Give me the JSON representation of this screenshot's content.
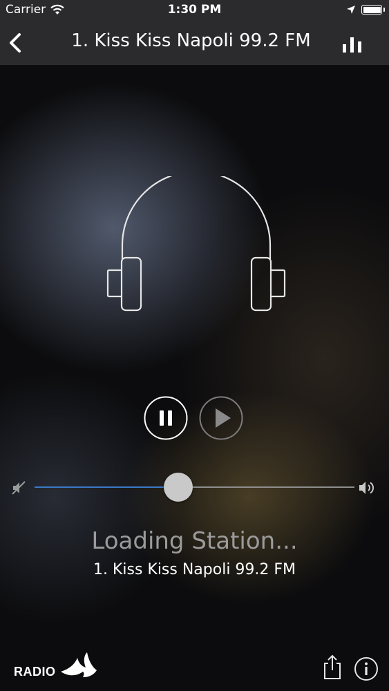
{
  "status_bar": {
    "carrier": "Carrier",
    "time": "1:30 PM",
    "wifi_icon": "wifi-icon",
    "location_icon": "location-arrow-icon",
    "battery_icon": "battery-full-icon"
  },
  "nav": {
    "title": "1. Kiss Kiss Napoli 99.2 FM",
    "back_icon": "chevron-left-icon",
    "right_icon": "equalizer-bars-icon"
  },
  "artwork": {
    "icon": "headphones-icon"
  },
  "controls": {
    "pause_icon": "pause-icon",
    "play_icon": "play-icon"
  },
  "volume": {
    "level": 0.45,
    "min_icon": "volume-mute-icon",
    "max_icon": "volume-up-icon",
    "fill_color": "#3a78c8"
  },
  "now_playing": {
    "status": "Loading Station...",
    "station": "1. Kiss Kiss Napoli 99.2 FM"
  },
  "footer": {
    "logo_text": "RADIO",
    "logo_icon": "swift-bird-icon",
    "share_icon": "share-icon",
    "info_icon": "info-icon"
  }
}
